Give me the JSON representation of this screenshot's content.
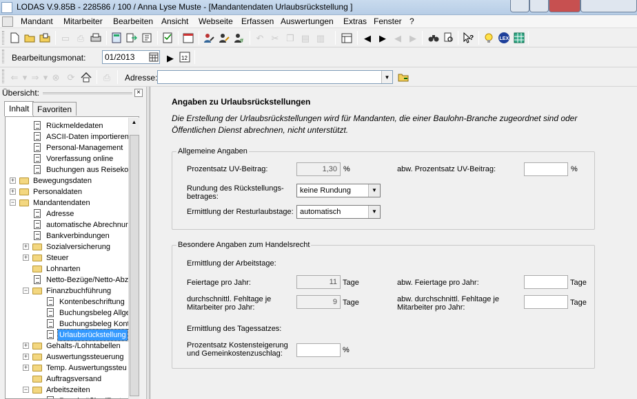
{
  "window": {
    "title": "LODAS V.9.85B - 228586 / 100 / Anna Lyse Muste - [Mandantendaten Urlaubsrückstellung ]"
  },
  "menu": [
    "Mandant",
    "Mitarbeiter",
    "Bearbeiten",
    "Ansicht",
    "Webseite",
    "Erfassen",
    "Auswertungen",
    "Extras",
    "Fenster",
    "?"
  ],
  "period": {
    "label": "Bearbeitungsmonat:",
    "value": "01/2013"
  },
  "address_bar": {
    "label": "Adresse:",
    "value": ""
  },
  "overview": {
    "title": "Übersicht:",
    "tabs": [
      "Inhalt",
      "Favoriten"
    ],
    "tree": [
      {
        "label": "Rückmeldedaten",
        "level": 2,
        "type": "doc"
      },
      {
        "label": "ASCII-Daten importieren",
        "level": 2,
        "type": "doc"
      },
      {
        "label": "Personal-Management",
        "level": 2,
        "type": "doc"
      },
      {
        "label": "Vorerfassung online",
        "level": 2,
        "type": "doc"
      },
      {
        "label": "Buchungen aus Reisekos",
        "level": 2,
        "type": "doc"
      },
      {
        "label": "Bewegungsdaten",
        "level": 1,
        "type": "folder",
        "exp": "+"
      },
      {
        "label": "Personaldaten",
        "level": 1,
        "type": "folder",
        "exp": "+"
      },
      {
        "label": "Mandantendaten",
        "level": 1,
        "type": "folder",
        "exp": "-"
      },
      {
        "label": "Adresse",
        "level": 2,
        "type": "doc"
      },
      {
        "label": "automatische Abrechnur",
        "level": 2,
        "type": "doc"
      },
      {
        "label": "Bankverbindungen",
        "level": 2,
        "type": "doc"
      },
      {
        "label": "Sozialversicherung",
        "level": 2,
        "type": "folder",
        "exp": "+"
      },
      {
        "label": "Steuer",
        "level": 2,
        "type": "folder",
        "exp": "+"
      },
      {
        "label": "Lohnarten",
        "level": 2,
        "type": "folder"
      },
      {
        "label": "Netto-Bezüge/Netto-Abz",
        "level": 2,
        "type": "doc"
      },
      {
        "label": "Finanzbuchführung",
        "level": 2,
        "type": "folder",
        "exp": "-"
      },
      {
        "label": "Kontenbeschriftung",
        "level": 3,
        "type": "doc"
      },
      {
        "label": "Buchungsbeleg Allge",
        "level": 3,
        "type": "doc"
      },
      {
        "label": "Buchungsbeleg Konte",
        "level": 3,
        "type": "doc"
      },
      {
        "label": "Urlaubsrückstellung",
        "level": 3,
        "type": "doc",
        "selected": true
      },
      {
        "label": "Gehalts-/Lohntabellen",
        "level": 2,
        "type": "folder",
        "exp": "+"
      },
      {
        "label": "Auswertungssteuerung",
        "level": 2,
        "type": "folder",
        "exp": "+"
      },
      {
        "label": "Temp. Auswertungssteu",
        "level": 2,
        "type": "folder",
        "exp": "+"
      },
      {
        "label": "Auftragsversand",
        "level": 2,
        "type": "folder"
      },
      {
        "label": "Arbeitszeiten",
        "level": 2,
        "type": "folder",
        "exp": "-"
      },
      {
        "label": "Regelmäßige/Feste A",
        "level": 3,
        "type": "doc"
      }
    ]
  },
  "content": {
    "heading": "Angaben zu Urlaubsrückstellungen",
    "note": "Die Erstellung der Urlaubsrückstellungen wird für Mandanten, die einer Baulohn-Branche zugeordnet sind oder Öffentlichen Dienst abrechnen, nicht unterstützt.",
    "general": {
      "title": "Allgemeine Angaben",
      "uv_label": "Prozentsatz UV-Beitrag:",
      "uv_value": "1,30",
      "uv_unit": "%",
      "abw_uv_label": "abw. Prozentsatz UV-Beitrag:",
      "abw_uv_value": "",
      "abw_uv_unit": "%",
      "rounding_label": "Rundung des Rückstellungs-betrages:",
      "rounding_value": "keine Rundung",
      "remaining_label": "Ermittlung der Resturlaubstage:",
      "remaining_value": "automatisch"
    },
    "commercial": {
      "title": "Besondere Angaben zum Handelsrecht",
      "workdays_heading": "Ermittlung der Arbeitstage:",
      "holidays_label": "Feiertage pro Jahr:",
      "holidays_value": "11",
      "holidays_unit": "Tage",
      "abw_holidays_label": "abw. Feiertage pro Jahr:",
      "abw_holidays_value": "",
      "abw_holidays_unit": "Tage",
      "absence_label": "durchschnittl. Fehltage je Mitarbeiter pro Jahr:",
      "absence_value": "9",
      "absence_unit": "Tage",
      "abw_absence_label": "abw. durchschnittl. Fehltage je Mitarbeiter pro Jahr:",
      "abw_absence_value": "",
      "abw_absence_unit": "Tage",
      "daily_heading": "Ermittlung des Tagessatzes:",
      "cost_label": "Prozentsatz Kostensteigerung und Gemeinkostenzuschlag:",
      "cost_value": "",
      "cost_unit": "%"
    }
  }
}
